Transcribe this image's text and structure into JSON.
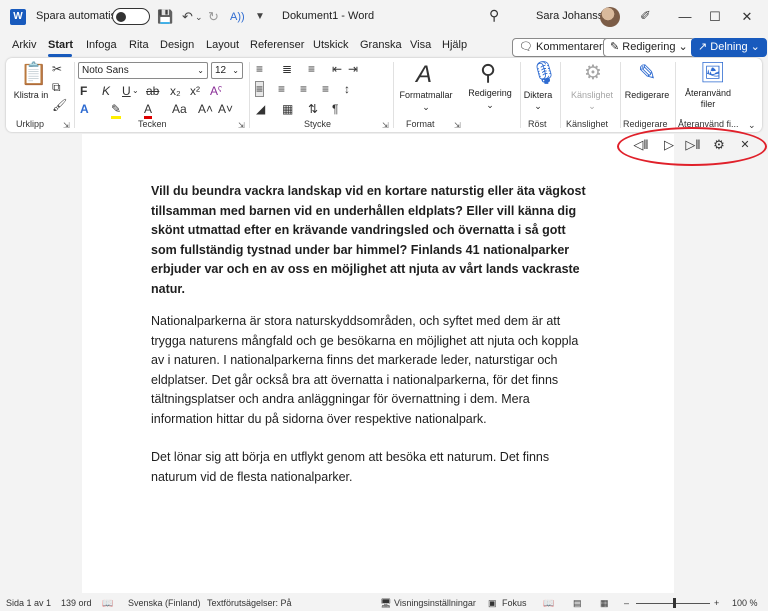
{
  "titlebar": {
    "autosave_label": "Spara automatiskt",
    "doc_title": "Dokument1 - Word",
    "user_name": "Sara Johansson",
    "app_logo": "W"
  },
  "tabs": [
    "Arkiv",
    "Start",
    "Infoga",
    "Rita",
    "Design",
    "Layout",
    "Referenser",
    "Utskick",
    "Granska",
    "Visa",
    "Hjälp"
  ],
  "header_buttons": {
    "comments": "Kommentarer",
    "editing": "Redigering",
    "share": "Delning"
  },
  "ribbon": {
    "paste_label": "Klistra in",
    "font_name": "Noto Sans",
    "font_size": "12",
    "format_label": "Formatmallar",
    "edit_label": "Redigering",
    "dictate_label": "Diktera",
    "sensitivity_label": "Känslighet",
    "editor_label": "Redigerare",
    "reuse_label": "Återanvänd filer",
    "groups": {
      "clipboard": "Urklipp",
      "font": "Tecken",
      "paragraph": "Stycke",
      "format": "Format",
      "voice": "Röst",
      "sensitivity": "Känslighet",
      "editor": "Redigerare",
      "reuse": "Återanvänd fi..."
    }
  },
  "document": {
    "intro": "Vill du beundra vackra landskap vid en kortare naturstig eller äta vägkost tillsamman med barnen vid en underhållen eldplats? Eller vill känna dig skönt utmattad efter en krävande vandringsled och övernatta i så gott som fullständig tystnad under bar himmel? Finlands 41 nationalparker erbjuder var och en av oss en möjlighet att njuta av vårt lands vackraste natur.",
    "para1": "Nationalparkerna är stora naturskyddsområden, och syftet med dem är att trygga naturens mångfald och ge besökarna en möjlighet att njuta och koppla av i naturen. I nationalparkerna finns det markerade leder, naturstigar och eldplatser. Det går också bra att övernatta i nationalparkerna, för det finns tältningsplatser och andra anläggningar för övernattning i dem. Mera information hittar du på sidorna över respektive nationalpark.",
    "para2": "Det lönar sig att börja en utflykt genom att besöka ett naturum. Det finns naturum vid de flesta nationalparker."
  },
  "status": {
    "page": "Sida 1 av 1",
    "words": "139 ord",
    "language": "Svenska (Finland)",
    "predictions": "Textförutsägelser: På",
    "display_settings": "Visningsinställningar",
    "focus": "Fokus",
    "zoom": "100 %"
  },
  "colors": {
    "accent": "#185abd",
    "highlight_ring": "#e0202a"
  }
}
